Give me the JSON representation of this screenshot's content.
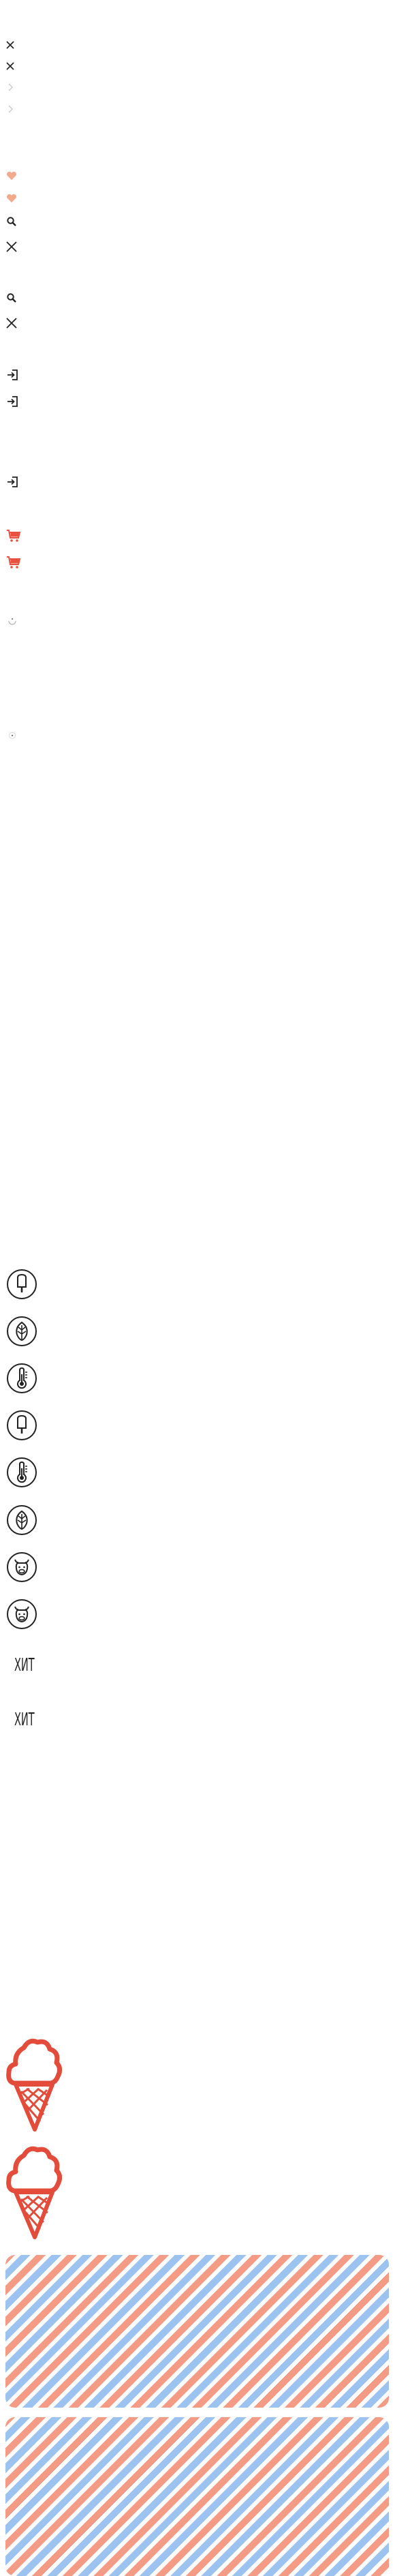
{
  "sprite": {
    "hit_labels": [
      "ХИТ",
      "ХИТ"
    ]
  },
  "colors": {
    "icon_dark": "#222222",
    "icon_faded": "#cfcfcf",
    "heart": "#f3a98c",
    "cart": "#e8513f",
    "cone": "#e34c3a",
    "stripe_pink": "#f49b86",
    "stripe_blue": "#9cc3ef"
  },
  "icons": [
    "close-icon",
    "close-icon",
    "chevron-right-icon",
    "chevron-right-icon",
    "heart-icon",
    "heart-icon",
    "search-icon",
    "close-icon",
    "search-icon",
    "close-icon",
    "login-icon",
    "login-icon",
    "login-icon",
    "cart-icon",
    "cart-icon",
    "spinner-icon",
    "spinner-icon",
    "popsicle-badge-icon",
    "leaf-badge-icon",
    "thermometer-badge-icon",
    "popsicle-badge-icon",
    "thermometer-badge-icon",
    "leaf-badge-icon",
    "cow-badge-icon",
    "cow-badge-icon",
    "ice-cream-cone-icon",
    "ice-cream-cone-icon",
    "striped-background",
    "striped-background"
  ]
}
